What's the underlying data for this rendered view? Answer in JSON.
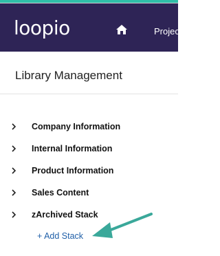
{
  "app": {
    "logo_text": "loopio"
  },
  "navbar": {
    "home_icon": "home-icon",
    "projects_label": "Projec"
  },
  "page": {
    "title": "Library Management"
  },
  "stacks": [
    {
      "label": "Company Information"
    },
    {
      "label": "Internal Information"
    },
    {
      "label": "Product Information"
    },
    {
      "label": "Sales Content"
    },
    {
      "label": "zArchived Stack"
    }
  ],
  "actions": {
    "add_stack_label": "+ Add Stack"
  },
  "colors": {
    "accent": "#2fbfa8",
    "navbar": "#2e2456",
    "link": "#1f5fa8",
    "annotation_arrow": "#3aa89a"
  }
}
